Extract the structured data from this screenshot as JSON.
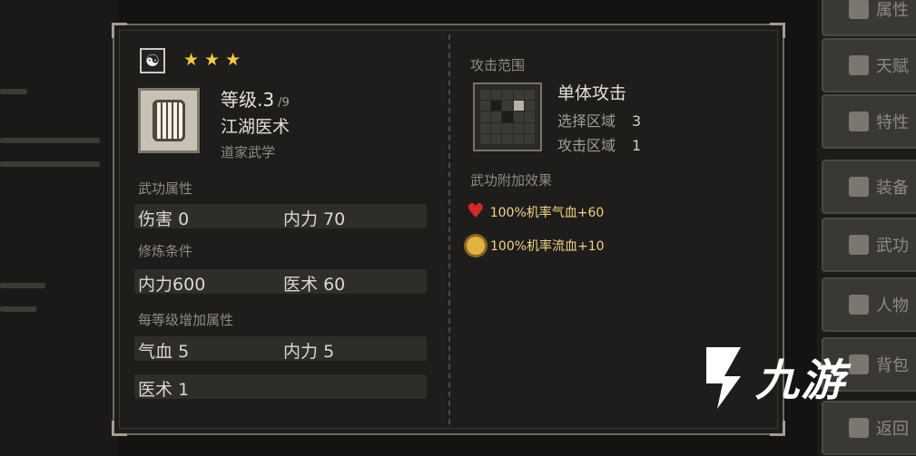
{
  "panel": {
    "stars": [
      "★",
      "★",
      "★"
    ],
    "level_label": "等级.3",
    "level_max": "/9",
    "skill_name": "江湖医术",
    "school": "道家武学",
    "section_attrs": "武功属性",
    "attrs": [
      {
        "label": "伤害",
        "value": "0"
      },
      {
        "label": "内力",
        "value": "70"
      }
    ],
    "section_requirements": "修炼条件",
    "requirements": [
      {
        "label": "内力",
        "value": "600"
      },
      {
        "label": "医术",
        "value": "60"
      }
    ],
    "section_per_level": "每等级增加属性",
    "per_level_row1": [
      {
        "label": "气血",
        "value": "5"
      },
      {
        "label": "内力",
        "value": "5"
      }
    ],
    "per_level_row2": [
      {
        "label": "医术",
        "value": "1"
      }
    ],
    "attack_range_title": "攻击范围",
    "range_type": "单体攻击",
    "select_area_label": "选择区域",
    "select_area_value": "3",
    "attack_area_label": "攻击区域",
    "attack_area_value": "1",
    "effects_title": "武功附加效果",
    "effects": [
      {
        "icon": "heart-icon",
        "text": "100%机率气血+60"
      },
      {
        "icon": "blood-splash-icon",
        "text": "100%机率流血+10"
      }
    ]
  },
  "sidebar": [
    "属性",
    "天赋",
    "特性",
    "装备",
    "武功",
    "人物",
    "背包",
    "返回"
  ],
  "watermark": {
    "text": "九游"
  },
  "colors": {
    "accent": "#f2c84a",
    "effect_text": "#f0d38a",
    "heart": "#d12a2a"
  }
}
